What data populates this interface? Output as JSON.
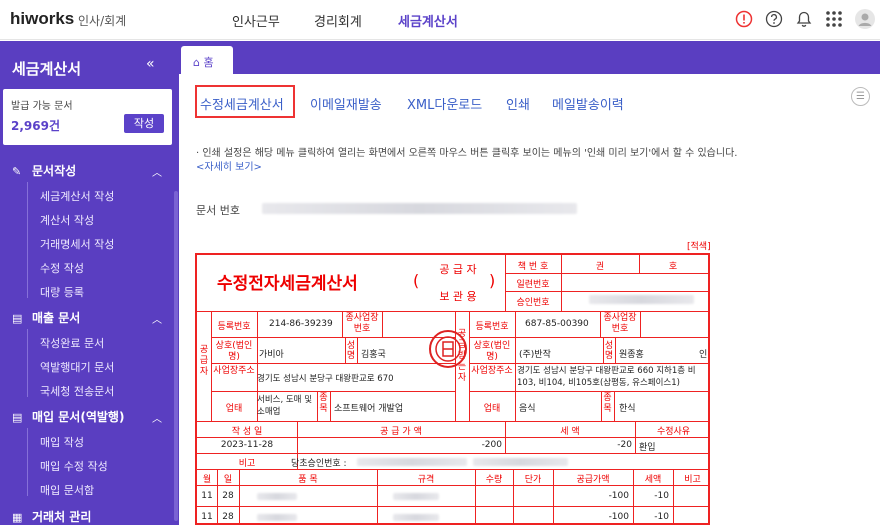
{
  "topbar": {
    "logo": "hiworks",
    "logo_sub": "인사/회계",
    "nav": [
      "인사근무",
      "경리회계",
      "세금계산서"
    ],
    "icons": [
      "alert-icon",
      "help-icon",
      "bell-icon",
      "apps-icon",
      "avatar"
    ]
  },
  "sidebar": {
    "title": "세금계산서",
    "collapse": "«",
    "card": {
      "label": "발급 가능 문서",
      "count": "2,969건",
      "button": "작성"
    },
    "sections": [
      {
        "label": "문서작성",
        "items": [
          "세금계산서 작성",
          "계산서 작성",
          "거래명세서 작성",
          "수정 작성",
          "대량 등록"
        ]
      },
      {
        "label": "매출 문서",
        "items": [
          "작성완료 문서",
          "역발행대기 문서",
          "국세청 전송문서"
        ]
      },
      {
        "label": "매입 문서(역발행)",
        "items": [
          "매입 작성",
          "매입 수정 작성",
          "매입 문서함"
        ]
      },
      {
        "label": "거래처 관리",
        "items": []
      }
    ]
  },
  "tabs": {
    "home": "홈"
  },
  "subnav": [
    "수정세금계산서",
    "이메일재발송",
    "XML다운로드",
    "인쇄",
    "메일발송이력"
  ],
  "info": {
    "text": "· 인쇄 설정은 해당 메뉴 클릭하여 열리는 화면에서 오른쪽 마우스 버튼 클릭후 보이는 메뉴의 '인쇄 미리 보기'에서 할 수 있습니다.",
    "link": "<자세히 보기>"
  },
  "doc": {
    "number_label": "문서 번호",
    "tag": "[적색]"
  },
  "invoice": {
    "title": "수정전자세금계산서",
    "paren_open": "(",
    "paren_close": ")",
    "role_top": "공  급  자",
    "role_bottom": "보  관  용",
    "book_label": "책 번 호",
    "book_unit1": "권",
    "book_unit2": "호",
    "serial_label": "일련번호",
    "approval_label": "승인번호",
    "supplier_side": "공급자",
    "buyer_side": "공급받는자",
    "reg_label": "등록번호",
    "branch_label": "종사업장번호",
    "name_label": "상호(법인명)",
    "rep_label": "성명",
    "addr_label": "사업장주소",
    "biz_label": "업태",
    "item_label": "종목",
    "supplier": {
      "reg": "214-86-39239",
      "name": "가비아",
      "rep": "김홍국",
      "addr": "경기도 성남시 분당구 대왕판교로 670",
      "biz": "서비스, 도매 및 소매업",
      "item": "소프트웨어 개발업"
    },
    "buyer": {
      "reg": "687-85-00390",
      "name": "(주)반작",
      "rep": "원종홍",
      "seal": "인",
      "addr": "경기도 성남시 분당구 대왕판교로 660 지하1층 비103, 비104, 비105호(삼평동, 유스페이스1)",
      "biz": "음식",
      "item": "한식"
    },
    "summary_headers": [
      "작 성 일",
      "공  급  가  액",
      "세    액",
      "수정사유"
    ],
    "summary": {
      "date": "2023-11-28",
      "supply": "-200",
      "tax": "-20",
      "reason": "환입"
    },
    "note_label": "비고",
    "note_value": "당초승인번호 :",
    "line_headers": [
      "월",
      "일",
      "품    목",
      "규격",
      "수량",
      "단가",
      "공급가액",
      "세액",
      "비고"
    ],
    "lines": [
      {
        "month": "11",
        "day": "28",
        "supply": "-100",
        "tax": "-10"
      },
      {
        "month": "11",
        "day": "28",
        "supply": "-100",
        "tax": "-10"
      }
    ]
  },
  "colors": {
    "brand": "#5a3ec1",
    "accent": "#5b42c9",
    "invoice_red": "#e22",
    "link": "#3a5fc8"
  }
}
